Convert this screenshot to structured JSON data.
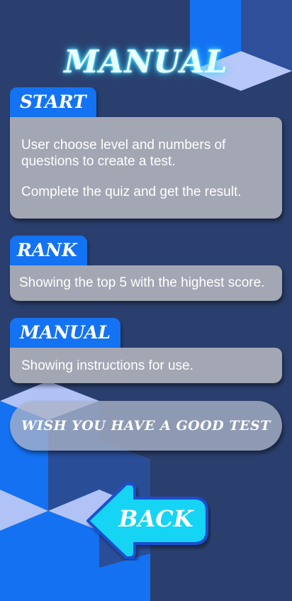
{
  "title": "MANUAL",
  "sections": [
    {
      "tab": "START",
      "paragraphs": [
        "User choose level and numbers of questions to create a test.",
        "Complete the quiz and get the result."
      ]
    },
    {
      "tab": "RANK",
      "paragraphs": [
        "Showing the top 5 with the highest score."
      ]
    },
    {
      "tab": "MANUAL",
      "paragraphs": [
        "Showing instructions for use."
      ]
    }
  ],
  "wish": "WISH YOU HAVE A GOOD TEST",
  "back_label": "BACK",
  "colors": {
    "background": "#2b3f6e",
    "tab": "#1473f2",
    "card": "#a3a6b3",
    "back_button": "#14d4f4",
    "title_glow": "#4fe6ff"
  },
  "icons": {
    "back": "arrow-left-icon"
  }
}
